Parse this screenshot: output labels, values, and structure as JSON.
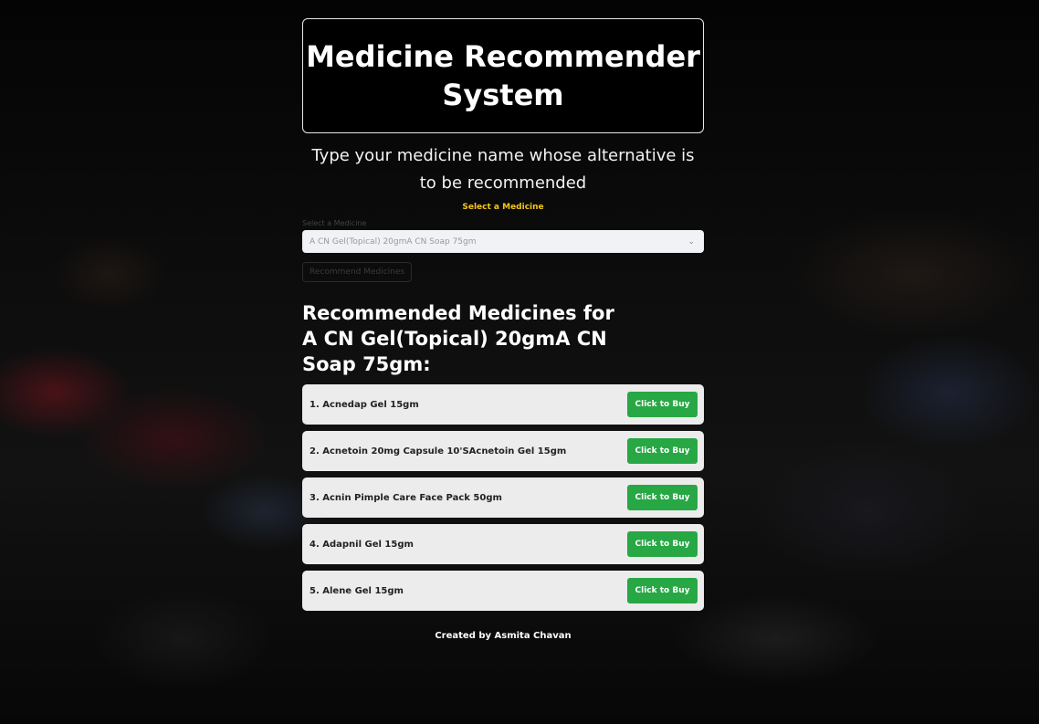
{
  "header": {
    "title": "Medicine Recommender System"
  },
  "subtitle": "Type your medicine name whose alternative is to be recommended",
  "select": {
    "caption": "Select a Medicine",
    "label": "Select a Medicine",
    "value": "A CN Gel(Topical) 20gmA CN Soap 75gm",
    "chevron_icon": "chevron-down-icon"
  },
  "recommend_button": {
    "label": "Recommend Medicines"
  },
  "results": {
    "title": "Recommended Medicines for A CN Gel(Topical) 20gmA CN Soap 75gm:",
    "buy_label": "Click to Buy",
    "items": [
      {
        "name": "1. Acnedap Gel 15gm"
      },
      {
        "name": "2. Acnetoin 20mg Capsule 10'SAcnetoin Gel 15gm"
      },
      {
        "name": "3. Acnin Pimple Care Face Pack 50gm"
      },
      {
        "name": "4. Adapnil Gel 15gm"
      },
      {
        "name": "5. Alene Gel 15gm"
      }
    ]
  },
  "footer": {
    "text": "Created by Asmita Chavan"
  },
  "colors": {
    "accent": "#f5c518",
    "buy": "#28a745",
    "card": "#ececec"
  }
}
